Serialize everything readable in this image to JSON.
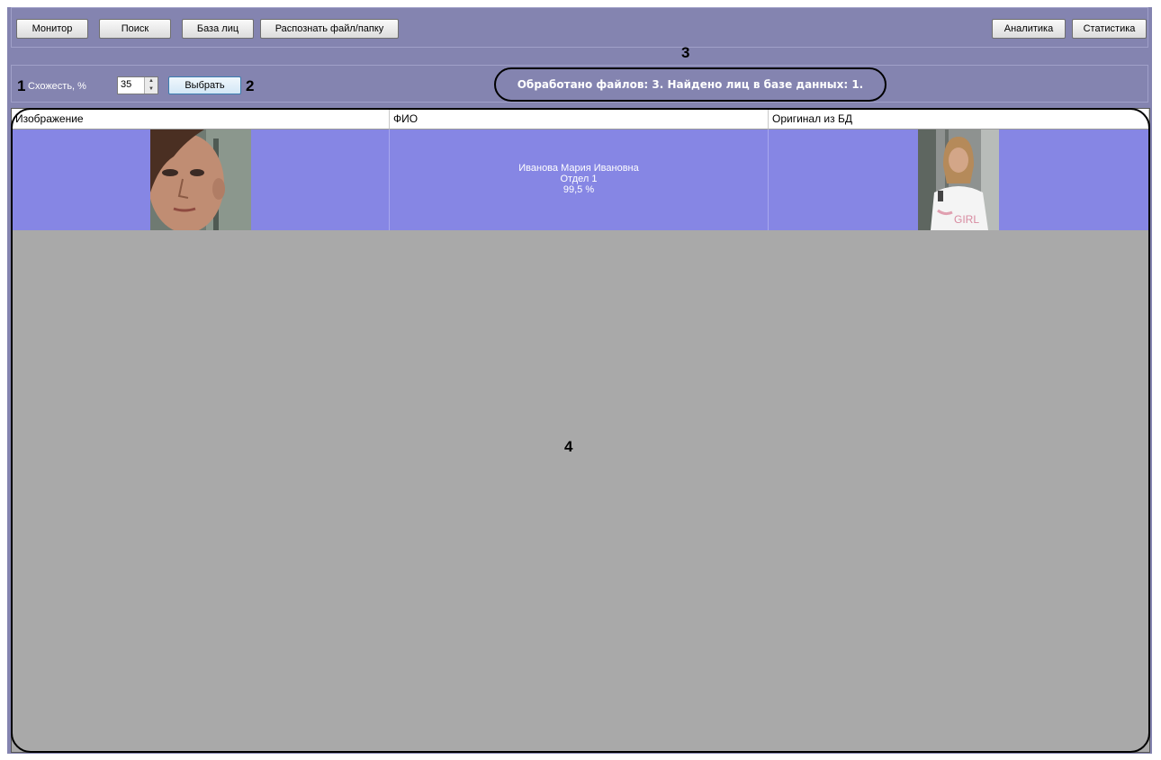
{
  "toolbar": {
    "left_buttons": [
      "Монитор",
      "Поиск",
      "База лиц",
      "Распознать файл/папку"
    ],
    "right_buttons": [
      "Аналитика",
      "Статистика"
    ]
  },
  "filter": {
    "similarity_label": "Схожесть, %",
    "similarity_value": "35",
    "select_button": "Выбрать"
  },
  "status_text": "Обработано файлов: 3. Найдено лиц в базе данных: 1.",
  "callouts": [
    "1",
    "2",
    "3",
    "4"
  ],
  "grid": {
    "columns": [
      "Изображение",
      "ФИО",
      "Оригинал из БД"
    ],
    "rows": [
      {
        "name": "Иванова Мария Ивановна",
        "department": "Отдел 1",
        "similarity": "99,5 %",
        "image_icon": "face-crop-photo",
        "original_icon": "original-photo"
      }
    ]
  },
  "colors": {
    "frame": "#8484b0",
    "row_highlight": "#8686e4",
    "grid_background": "#a9a9a9"
  }
}
